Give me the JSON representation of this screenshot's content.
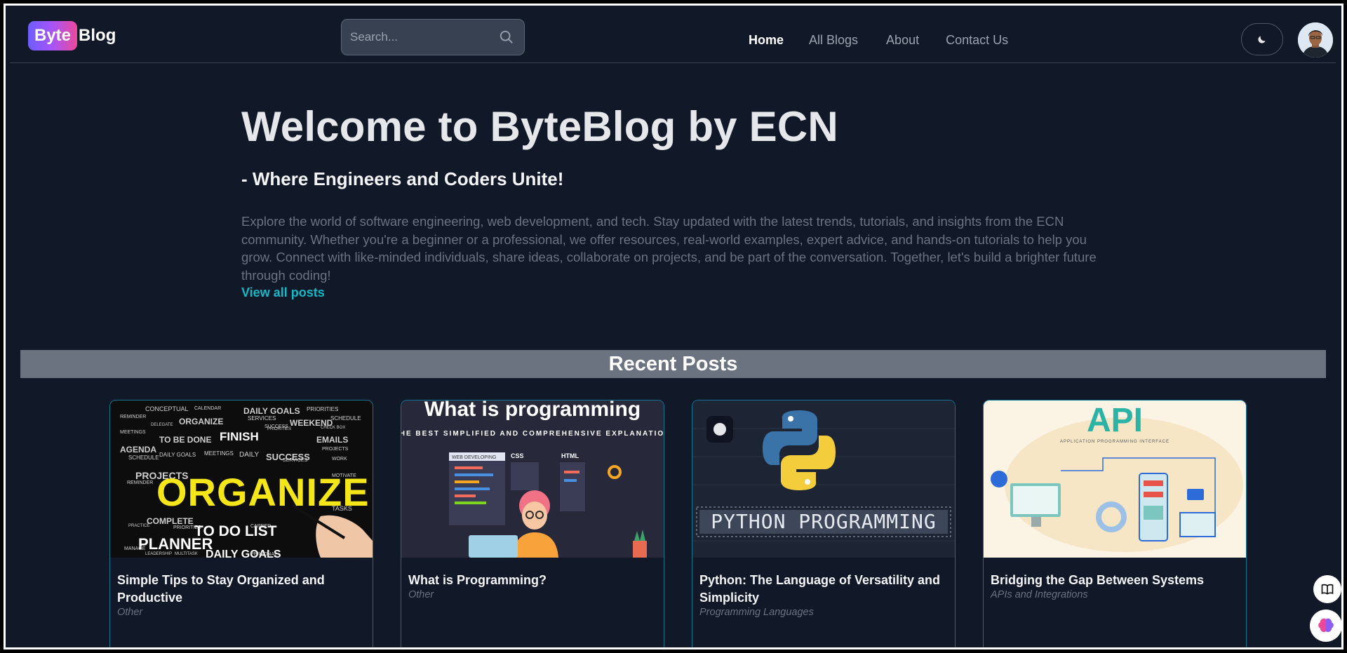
{
  "header": {
    "logo_byte": "Byte",
    "logo_blog": "Blog",
    "search_placeholder": "Search...",
    "nav": [
      {
        "label": "Home",
        "active": true
      },
      {
        "label": "All Blogs",
        "active": false
      },
      {
        "label": "About",
        "active": false
      },
      {
        "label": "Contact Us",
        "active": false
      }
    ]
  },
  "hero": {
    "title": "Welcome to ByteBlog by ECN",
    "subtitle": "- Where Engineers and Coders Unite!",
    "description": "Explore the world of software engineering, web development, and tech. Stay updated with the latest trends, tutorials, and insights from the ECN community. Whether you're a beginner or a professional, we offer resources, real-world examples, expert advice, and hands-on tutorials to help you grow. Connect with like-minded individuals, share ideas, collaborate on projects, and be part of the conversation. Together, let's build a brighter future through coding!",
    "view_all_label": "View all posts"
  },
  "recent": {
    "heading": "Recent Posts",
    "posts": [
      {
        "title": "Simple Tips to Stay Organized and Productive",
        "category": "Other",
        "image": "organize-word-cloud"
      },
      {
        "title": "What is Programming?",
        "category": "Other",
        "image": "programmer-illustration",
        "image_text": {
          "headline": "What is programming",
          "tagline": "THE BEST SIMPLIFIED AND COMPREHENSIVE EXPLANATION",
          "panel1": "WEB DEVELOPING",
          "panel2": "CSS",
          "panel3": "HTML"
        }
      },
      {
        "title": "Python: The Language of Versatility and Simplicity",
        "category": "Programming Languages",
        "image": "python-logo",
        "image_text": {
          "banner": "PYTHON PROGRAMMING"
        }
      },
      {
        "title": "Bridging the Gap Between Systems",
        "category": "APIs and Integrations",
        "image": "api-illustration",
        "image_text": {
          "headline": "API",
          "tagline": "APPLICATION PROGRAMMING INTERFACE"
        }
      }
    ]
  },
  "organize_words": [
    "CONCEPTUAL",
    "CALENDAR",
    "DAILY GOALS",
    "PRIORITIES",
    "REMINDER",
    "ORGANIZE",
    "SERVICES",
    "WEEKEND",
    "SCHEDULE",
    "DELEGATE",
    "SUCCESS",
    "FINISH",
    "PRIORITIES",
    "CHECK BOX",
    "MEETINGS",
    "TO BE DONE",
    "EMAILS",
    "AGENDA",
    "DAILY GOALS",
    "MEETINGS",
    "DAILY",
    "SUCCESS",
    "PROJECTS",
    "SCHEDULE",
    "SERVICES",
    "WORK",
    "PROJECTS",
    "REMINDER",
    "MOTIVATE",
    "ORGANIZE",
    "COMPLETE",
    "TO DO LIST",
    "TASKS",
    "PLANNER",
    "DAILY GOALS",
    "PRIORITIES",
    "PRACTICE",
    "CAREER",
    "MANAGE",
    "LEADERSHIP",
    "MULTITASK",
    "PERSONAL"
  ],
  "colors": {
    "accent": "#14b8c6",
    "card_border": "#0e7490",
    "background": "#111827"
  }
}
